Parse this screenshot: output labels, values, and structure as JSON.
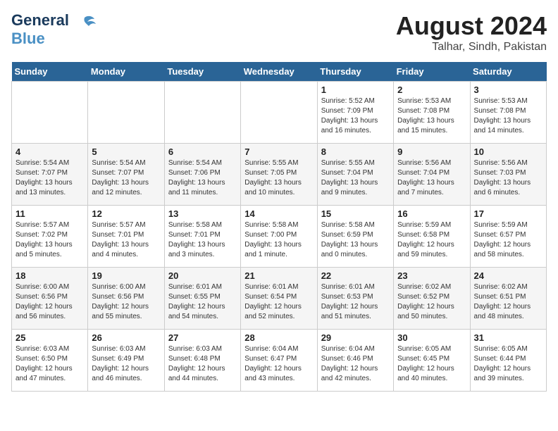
{
  "header": {
    "logo_general": "General",
    "logo_blue": "Blue",
    "month_year": "August 2024",
    "location": "Talhar, Sindh, Pakistan"
  },
  "calendar": {
    "days_of_week": [
      "Sunday",
      "Monday",
      "Tuesday",
      "Wednesday",
      "Thursday",
      "Friday",
      "Saturday"
    ],
    "weeks": [
      [
        {
          "day": "",
          "info": ""
        },
        {
          "day": "",
          "info": ""
        },
        {
          "day": "",
          "info": ""
        },
        {
          "day": "",
          "info": ""
        },
        {
          "day": "1",
          "info": "Sunrise: 5:52 AM\nSunset: 7:09 PM\nDaylight: 13 hours and 16 minutes."
        },
        {
          "day": "2",
          "info": "Sunrise: 5:53 AM\nSunset: 7:08 PM\nDaylight: 13 hours and 15 minutes."
        },
        {
          "day": "3",
          "info": "Sunrise: 5:53 AM\nSunset: 7:08 PM\nDaylight: 13 hours and 14 minutes."
        }
      ],
      [
        {
          "day": "4",
          "info": "Sunrise: 5:54 AM\nSunset: 7:07 PM\nDaylight: 13 hours and 13 minutes."
        },
        {
          "day": "5",
          "info": "Sunrise: 5:54 AM\nSunset: 7:07 PM\nDaylight: 13 hours and 12 minutes."
        },
        {
          "day": "6",
          "info": "Sunrise: 5:54 AM\nSunset: 7:06 PM\nDaylight: 13 hours and 11 minutes."
        },
        {
          "day": "7",
          "info": "Sunrise: 5:55 AM\nSunset: 7:05 PM\nDaylight: 13 hours and 10 minutes."
        },
        {
          "day": "8",
          "info": "Sunrise: 5:55 AM\nSunset: 7:04 PM\nDaylight: 13 hours and 9 minutes."
        },
        {
          "day": "9",
          "info": "Sunrise: 5:56 AM\nSunset: 7:04 PM\nDaylight: 13 hours and 7 minutes."
        },
        {
          "day": "10",
          "info": "Sunrise: 5:56 AM\nSunset: 7:03 PM\nDaylight: 13 hours and 6 minutes."
        }
      ],
      [
        {
          "day": "11",
          "info": "Sunrise: 5:57 AM\nSunset: 7:02 PM\nDaylight: 13 hours and 5 minutes."
        },
        {
          "day": "12",
          "info": "Sunrise: 5:57 AM\nSunset: 7:01 PM\nDaylight: 13 hours and 4 minutes."
        },
        {
          "day": "13",
          "info": "Sunrise: 5:58 AM\nSunset: 7:01 PM\nDaylight: 13 hours and 3 minutes."
        },
        {
          "day": "14",
          "info": "Sunrise: 5:58 AM\nSunset: 7:00 PM\nDaylight: 13 hours and 1 minute."
        },
        {
          "day": "15",
          "info": "Sunrise: 5:58 AM\nSunset: 6:59 PM\nDaylight: 13 hours and 0 minutes."
        },
        {
          "day": "16",
          "info": "Sunrise: 5:59 AM\nSunset: 6:58 PM\nDaylight: 12 hours and 59 minutes."
        },
        {
          "day": "17",
          "info": "Sunrise: 5:59 AM\nSunset: 6:57 PM\nDaylight: 12 hours and 58 minutes."
        }
      ],
      [
        {
          "day": "18",
          "info": "Sunrise: 6:00 AM\nSunset: 6:56 PM\nDaylight: 12 hours and 56 minutes."
        },
        {
          "day": "19",
          "info": "Sunrise: 6:00 AM\nSunset: 6:56 PM\nDaylight: 12 hours and 55 minutes."
        },
        {
          "day": "20",
          "info": "Sunrise: 6:01 AM\nSunset: 6:55 PM\nDaylight: 12 hours and 54 minutes."
        },
        {
          "day": "21",
          "info": "Sunrise: 6:01 AM\nSunset: 6:54 PM\nDaylight: 12 hours and 52 minutes."
        },
        {
          "day": "22",
          "info": "Sunrise: 6:01 AM\nSunset: 6:53 PM\nDaylight: 12 hours and 51 minutes."
        },
        {
          "day": "23",
          "info": "Sunrise: 6:02 AM\nSunset: 6:52 PM\nDaylight: 12 hours and 50 minutes."
        },
        {
          "day": "24",
          "info": "Sunrise: 6:02 AM\nSunset: 6:51 PM\nDaylight: 12 hours and 48 minutes."
        }
      ],
      [
        {
          "day": "25",
          "info": "Sunrise: 6:03 AM\nSunset: 6:50 PM\nDaylight: 12 hours and 47 minutes."
        },
        {
          "day": "26",
          "info": "Sunrise: 6:03 AM\nSunset: 6:49 PM\nDaylight: 12 hours and 46 minutes."
        },
        {
          "day": "27",
          "info": "Sunrise: 6:03 AM\nSunset: 6:48 PM\nDaylight: 12 hours and 44 minutes."
        },
        {
          "day": "28",
          "info": "Sunrise: 6:04 AM\nSunset: 6:47 PM\nDaylight: 12 hours and 43 minutes."
        },
        {
          "day": "29",
          "info": "Sunrise: 6:04 AM\nSunset: 6:46 PM\nDaylight: 12 hours and 42 minutes."
        },
        {
          "day": "30",
          "info": "Sunrise: 6:05 AM\nSunset: 6:45 PM\nDaylight: 12 hours and 40 minutes."
        },
        {
          "day": "31",
          "info": "Sunrise: 6:05 AM\nSunset: 6:44 PM\nDaylight: 12 hours and 39 minutes."
        }
      ]
    ]
  }
}
